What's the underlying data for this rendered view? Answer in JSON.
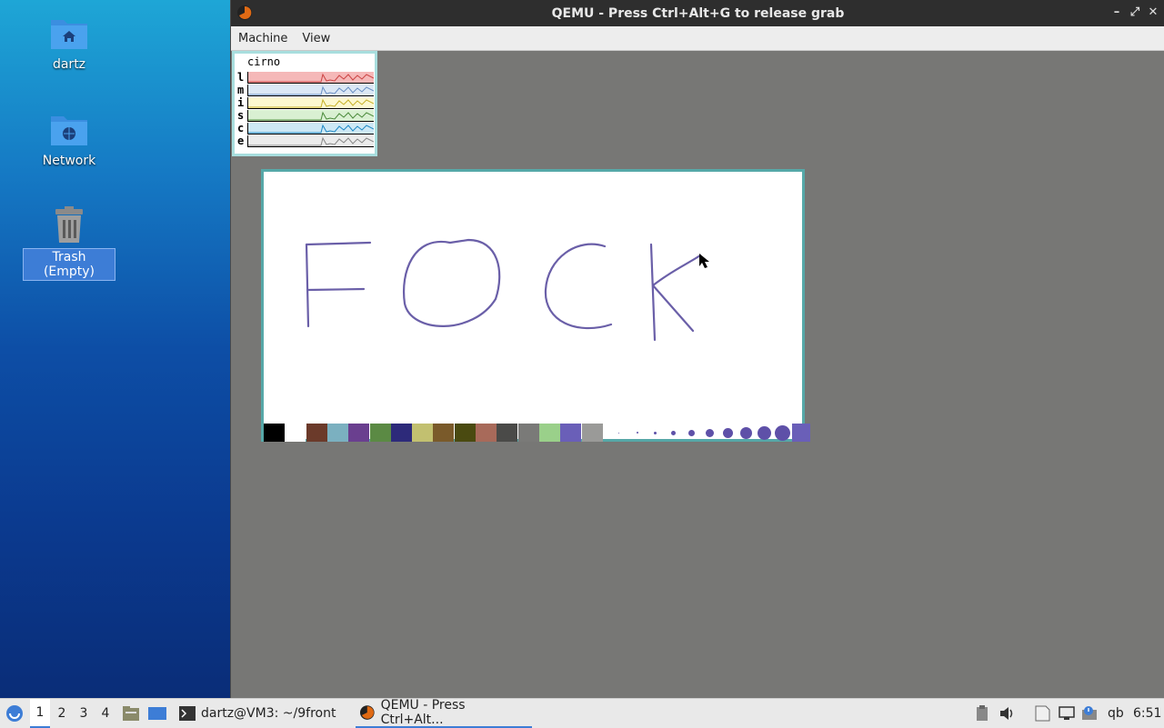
{
  "desktop": {
    "icons": [
      {
        "label": "dartz",
        "icon": "home-folder-icon"
      },
      {
        "label": "Network",
        "icon": "network-folder-icon"
      },
      {
        "label": "Trash (Empty)",
        "icon": "trash-icon",
        "selected": true
      }
    ]
  },
  "qemu": {
    "title": "QEMU - Press Ctrl+Alt+G to release grab",
    "menu": [
      "Machine",
      "View"
    ]
  },
  "stats": {
    "host": "cirno",
    "rows": [
      {
        "key": "l",
        "color": "#f5b8b8",
        "line": "#c44"
      },
      {
        "key": "m",
        "color": "#dce8f5",
        "line": "#6a8fc4"
      },
      {
        "key": "i",
        "color": "#fdf8d0",
        "line": "#c7b12a"
      },
      {
        "key": "s",
        "color": "#d9f0d2",
        "line": "#4a8a3a"
      },
      {
        "key": "c",
        "color": "#cde8f5",
        "line": "#1f88c4"
      },
      {
        "key": "e",
        "color": "#ececec",
        "line": "#888"
      }
    ]
  },
  "paint": {
    "drawing_text": "FOCK",
    "stroke_color": "#6a5fa8",
    "palette": [
      "#000000",
      "#ffffff",
      "#6b3a2a",
      "#7bb0c0",
      "#6a3f8f",
      "#5b8a44",
      "#2d2a7a",
      "#c2c070",
      "#7a5a2a",
      "#4a4a10",
      "#a86a5a",
      "#4a4a48",
      "#7a7a78",
      "#9ad08a",
      "#6a5fb8",
      "#9a9a98"
    ],
    "brush_sizes": [
      1,
      2,
      3,
      5,
      7,
      9,
      11,
      13,
      15,
      17
    ]
  },
  "taskbar": {
    "workspaces": [
      "1",
      "2",
      "3",
      "4"
    ],
    "active_workspace": "1",
    "tasks": [
      {
        "label": "dartz@VM3: ~/9front",
        "icon": "terminal-icon"
      },
      {
        "label": "QEMU - Press Ctrl+Alt...",
        "icon": "qemu-icon",
        "active": true
      }
    ],
    "tray_text": "qb",
    "clock": "6:51"
  }
}
